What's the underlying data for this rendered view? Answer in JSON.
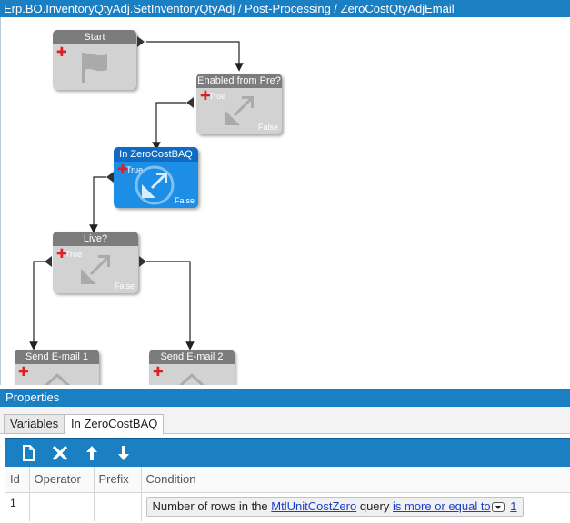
{
  "window": {
    "title": "Erp.BO.InventoryQtyAdj.SetInventoryQtyAdj / Post-Processing / ZeroCostQtyAdjEmail"
  },
  "workflow": {
    "nodes": {
      "start": {
        "title": "Start"
      },
      "enabled": {
        "title": "Enabled from Pre?",
        "true_label": "True",
        "false_label": "False"
      },
      "zerocost": {
        "title": "In ZeroCostBAQ",
        "true_label": "True",
        "false_label": "False"
      },
      "live": {
        "title": "Live?",
        "true_label": "True",
        "false_label": "False"
      },
      "email1": {
        "title": "Send E-mail 1"
      },
      "email2": {
        "title": "Send E-mail 2"
      }
    }
  },
  "properties": {
    "title": "Properties",
    "tabs": [
      {
        "label": "Variables"
      },
      {
        "label": "In ZeroCostBAQ"
      }
    ],
    "toolbar": {
      "new_icon": "new-document-icon",
      "delete_icon": "delete-x-icon",
      "up_icon": "arrow-up-icon",
      "down_icon": "arrow-down-icon"
    },
    "grid": {
      "columns": [
        "Id",
        "Operator",
        "Prefix",
        "Condition"
      ],
      "rows": [
        {
          "id": "1",
          "operator": "",
          "prefix": "",
          "condition": {
            "text1": "Number of rows in the",
            "link1": "MtlUnitCostZero",
            "text2": "query",
            "link2": "is more or equal to",
            "link3": "1"
          }
        }
      ]
    }
  },
  "colors": {
    "accent": "#1b7fc4",
    "node_selected": "#1c8ee6",
    "node_default": "#d2d2d2",
    "link": "#1a3fcf"
  }
}
